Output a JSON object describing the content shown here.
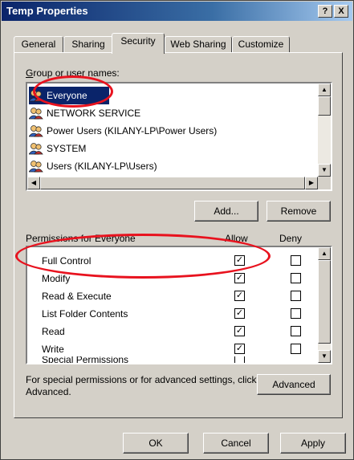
{
  "window": {
    "title": "Temp Properties",
    "help_glyph": "?",
    "close_glyph": "X"
  },
  "tabs": [
    "General",
    "Sharing",
    "Security",
    "Web Sharing",
    "Customize"
  ],
  "active_tab": "Security",
  "group_label": "Group or user names:",
  "group_items": [
    {
      "label": "Everyone",
      "selected": true,
      "icon": "users-icon"
    },
    {
      "label": "NETWORK SERVICE",
      "selected": false,
      "icon": "users-icon"
    },
    {
      "label": "Power Users (KILANY-LP\\Power Users)",
      "selected": false,
      "icon": "users-icon"
    },
    {
      "label": "SYSTEM",
      "selected": false,
      "icon": "users-icon"
    },
    {
      "label": "Users (KILANY-LP\\Users)",
      "selected": false,
      "icon": "users-icon"
    }
  ],
  "buttons": {
    "add": "Add...",
    "remove": "Remove",
    "advanced": "Advanced",
    "ok": "OK",
    "cancel": "Cancel",
    "apply": "Apply"
  },
  "permissions": {
    "label": "Permissions for Everyone",
    "allow_header": "Allow",
    "deny_header": "Deny",
    "rows": [
      {
        "name": "Full Control",
        "allow": true,
        "deny": false
      },
      {
        "name": "Modify",
        "allow": true,
        "deny": false
      },
      {
        "name": "Read & Execute",
        "allow": true,
        "deny": false
      },
      {
        "name": "List Folder Contents",
        "allow": true,
        "deny": false
      },
      {
        "name": "Read",
        "allow": true,
        "deny": false
      },
      {
        "name": "Write",
        "allow": true,
        "deny": false
      },
      {
        "name": "Special Permissions",
        "allow": false,
        "deny": false
      }
    ]
  },
  "advanced_note": "For special permissions or for advanced settings, click Advanced.",
  "colors": {
    "title_bar": "#0a246a",
    "selection": "#0a246a",
    "highlight_ellipse": "#e8121e",
    "face": "#d4d0c8"
  }
}
